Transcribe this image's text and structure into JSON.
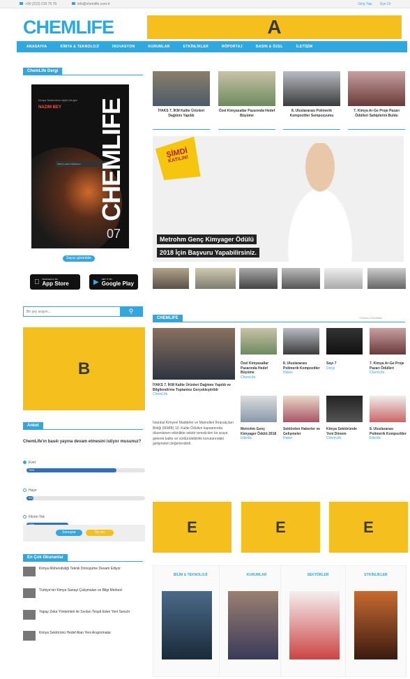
{
  "topbar": {
    "phone": "+90 (212) 219 75 76",
    "email": "info@chemlife.com.tr",
    "login": "Giriş Yap",
    "register": "Üye Ol"
  },
  "header": {
    "logo": "CHEMLIFE",
    "ad_label": "A"
  },
  "nav": {
    "items": [
      "ANASAYFA",
      "KİMYA & TEKNOLOJİ",
      "İNOVASYON",
      "KURUMLAR",
      "ETKİNLİKLER",
      "RÖPORTAJ",
      "BASIN & ÖZEL",
      "İLETİŞİM"
    ]
  },
  "sidebar": {
    "magazine_title": "ChemLife Dergi",
    "magazine_cover": {
      "small_text": "Kimya Sektörünün Aylık Dergisi",
      "red_text": "NAZIM BEY",
      "title": "CHEMLIFE",
      "issue": "07",
      "bar_text": "Click to view in fullscreen"
    },
    "read_button": "Sayıyı görüntüle",
    "app_store": {
      "small": "Download on the",
      "label": "App Store"
    },
    "google_play": {
      "small": "GET IT ON",
      "label": "Google Play"
    },
    "search_placeholder": "Bir şey arayın...",
    "ad_label": "B",
    "poll": {
      "title": "Anket",
      "question": "ChemLife'ın basılı yayına devam etmesini istiyor musunuz?",
      "options": [
        {
          "label": "Evet",
          "percent": "76%"
        },
        {
          "label": "Hayır",
          "percent": "6%"
        },
        {
          "label": "Fikrim Yok",
          "percent": "18%"
        }
      ],
      "vote_button": "Oy ver",
      "results_button": "Sonuçlar"
    },
    "popular": {
      "title": "En Çok Okunanlar",
      "items": [
        "Kimya Mühendisliği Teknik Dönüşüme Devam Ediyor",
        "Türkiye'nin Kimya Sanayi Çalışmaları ve Bilgi Merkezi",
        "Yapay Zeka Yöntemleri ile Sıvıları Tespit Eden Yeni Sensör",
        "Kimya Sektörünü Hedef Alan Yeni Araştırmalar"
      ]
    }
  },
  "main": {
    "top_cards": [
      "İYAKS 7. İKM Kalite Ürünleri Dağıtımı Yapıldı",
      "Özel Kimyasallar Pazarında Hedef Büyüme",
      "8. Uluslararası Polimerik Kompozitler Sempozyumu",
      "7. Kimya Ar-Ge Proje Pazarı Ödülleri Sahiplerini Buldu"
    ],
    "hero": {
      "badge_line1": "ŞİMDİ",
      "badge_line2": "KATILIN!",
      "caption1": "Metrohm Genç Kimyager Ödülü",
      "caption2": "2018 İçin Başvuru Yapabilirsiniz."
    },
    "chemlife_section": {
      "title": "CHEMLIFE",
      "more_link": "Tümünü Görüntüle",
      "lead_title": "İYAKS 7. İKM Kalite Ürünleri Dağıtımı Yapıldı ve Bilgilendirme Toplantısı Gerçekleştirildi",
      "lead_tag": "ChemLife",
      "lead_body": "İstanbul Kimyevi Maddeler ve Mamulleri İhracatçıları Birliği (İKMİB) 10. Kalite Ödülleri kapsamında düzenlenen etkinlikte sektör temsilcileri bir araya gelerek kalite ve sürdürülebilirlik konularındaki gelişmeleri değerlendirdi.",
      "grid": [
        {
          "title": "Özel Kimyasallar Pazarında Hedef Büyüme",
          "tag": "ChemLife"
        },
        {
          "title": "8. Uluslararası Polimerik Kompozitler",
          "tag": "Haber"
        },
        {
          "title": "Sayı 7",
          "tag": "Dergi"
        },
        {
          "title": "7. Kimya Ar-Ge Proje Pazarı Ödülleri",
          "tag": "ChemLife"
        },
        {
          "title": "Metrohm Genç Kimyager Ödülü 2018",
          "tag": "Etkinlik"
        },
        {
          "title": "Sektörden Haberler ve Gelişmeler",
          "tag": "Haber"
        },
        {
          "title": "Kimya Sektöründe Yeni Dönem",
          "tag": "ChemLife"
        },
        {
          "title": "8. Uluslararası Polimerik Kompozitler",
          "tag": "Etkinlik"
        }
      ]
    },
    "ads_e": [
      "E",
      "E",
      "E"
    ],
    "categories": [
      "BİLİM & TEKNOLOJİ",
      "KURUMLAR",
      "SEKTÖRLER",
      "ETKİNLİKLER"
    ]
  }
}
